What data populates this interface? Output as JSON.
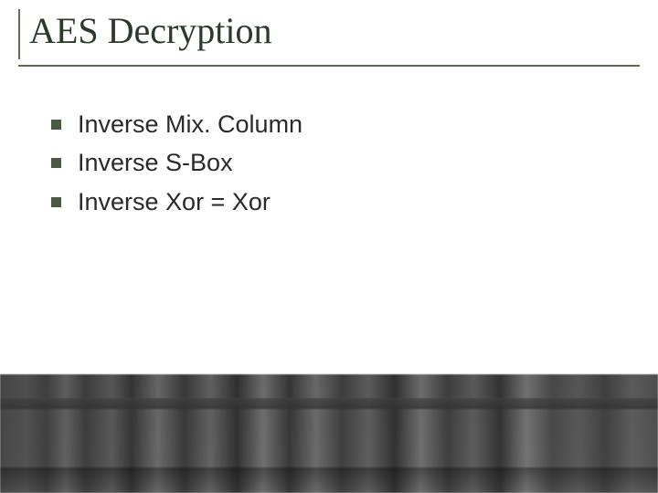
{
  "title": "AES Decryption",
  "bullets": [
    "Inverse Mix. Column",
    "Inverse S-Box",
    "Inverse Xor = Xor"
  ]
}
